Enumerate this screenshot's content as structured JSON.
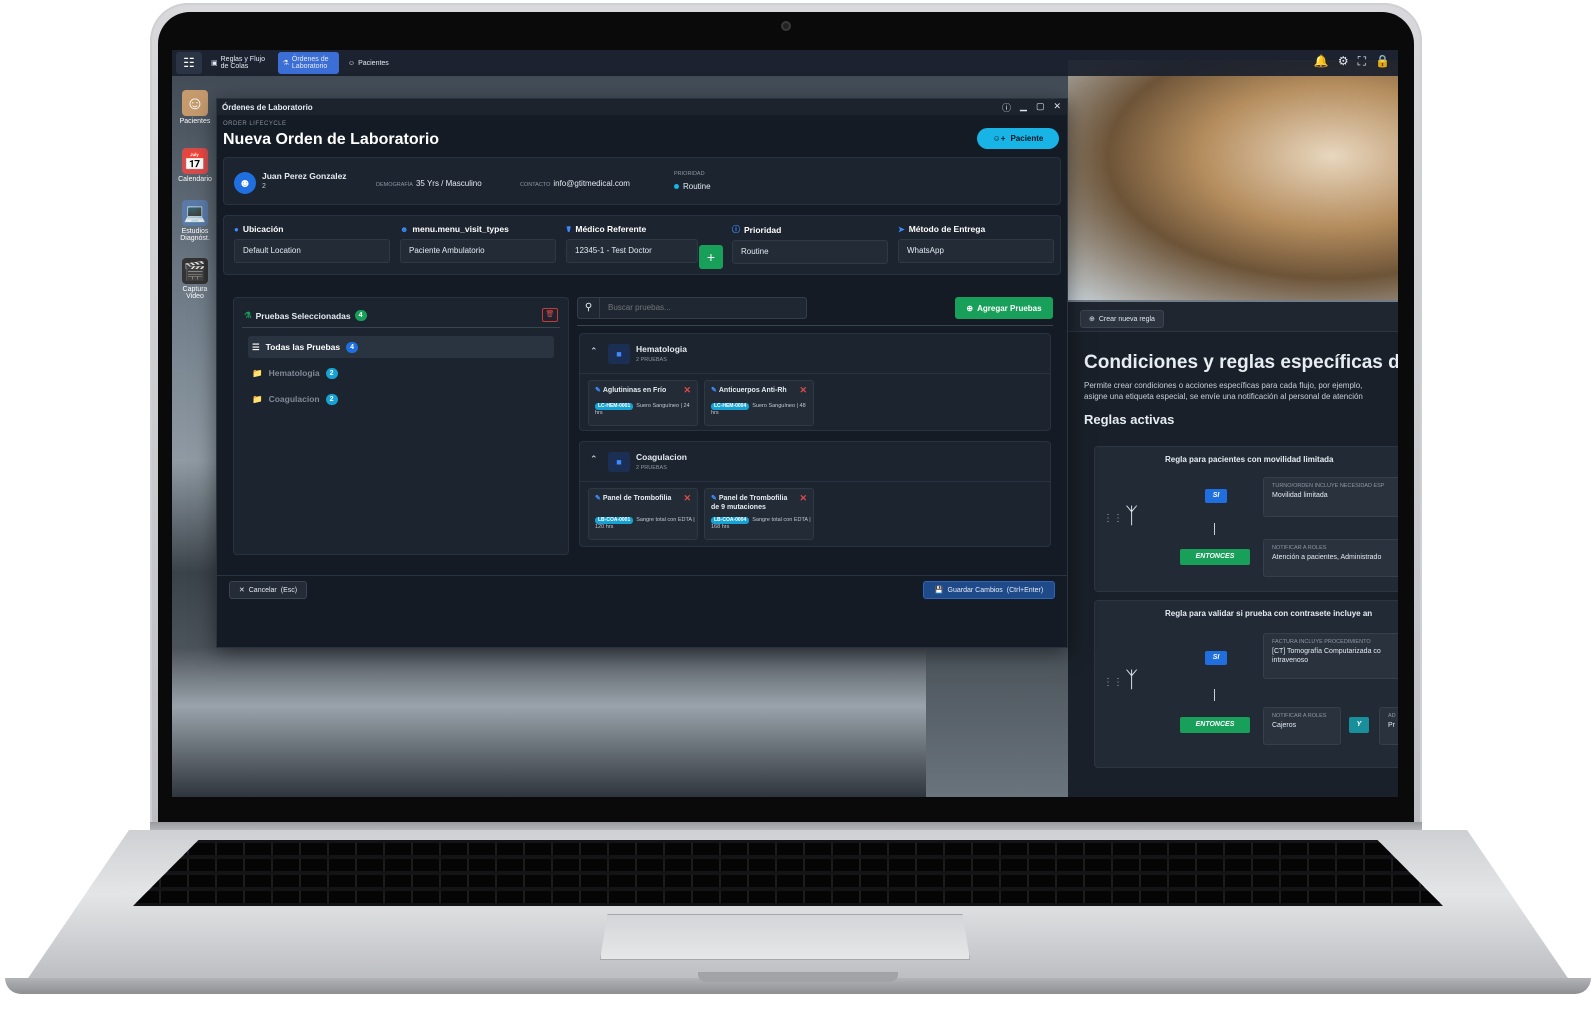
{
  "taskbar": {
    "tabs": [
      {
        "label": "Reglas y Flujo de Colas",
        "icon": "rules-icon"
      },
      {
        "label": "Órdenes de Laboratorio",
        "icon": "lab-icon"
      },
      {
        "label": "Pacientes",
        "icon": "patients-icon"
      }
    ]
  },
  "desktop": {
    "icons": [
      {
        "label": "Pacientes",
        "icon": "patients-icon"
      },
      {
        "label": "Calendario",
        "icon": "calendar-icon"
      },
      {
        "label": "Estudios Diagnóst.",
        "icon": "studies-icon"
      },
      {
        "label": "Captura Video",
        "icon": "video-icon"
      }
    ]
  },
  "modal": {
    "window_title": "Órdenes de Laboratorio",
    "lifecycle": "ORDER LIFECYCLE",
    "heading": "Nueva Orden de Laboratorio",
    "patient_button": "Paciente",
    "patient": {
      "name": "Juan Perez Gonzalez",
      "id": "2",
      "demo_label": "DEMOGRAFÍA",
      "demo_value": "35 Yrs / Masculino",
      "contact_label": "CONTACTO",
      "contact_value": "info@gtitmedical.com",
      "priority_label": "PRIORIDAD",
      "priority_value": "Routine"
    },
    "fields": [
      {
        "label": "Ubicación",
        "value": "Default Location",
        "icon": "location-pin-icon"
      },
      {
        "label": "menu.menu_visit_types",
        "value": "Paciente Ambulatorio",
        "icon": "person-icon"
      },
      {
        "label": "Médico Referente",
        "value": "12345-1 - Test Doctor",
        "icon": "stethoscope-icon"
      },
      {
        "label": "Prioridad",
        "value": "Routine",
        "icon": "info-icon"
      },
      {
        "label": "Método de Entrega",
        "value": "WhatsApp",
        "icon": "send-icon"
      }
    ],
    "selected": {
      "title": "Pruebas Seleccionadas",
      "count": "4",
      "items": [
        {
          "label": "Todas las Pruebas",
          "count": "4"
        },
        {
          "label": "Hematologia",
          "count": "2"
        },
        {
          "label": "Coagulacion",
          "count": "2"
        }
      ]
    },
    "search_placeholder": "Buscar pruebas...",
    "add_tests": "Agregar Pruebas",
    "groups": [
      {
        "name": "Hematologia",
        "count": "2 PRUEBAS",
        "tests": [
          {
            "name": "Aglutininas en Frío",
            "code": "LC-HEM-0001",
            "detail": "Suero Sanguíneo | 24 hrs"
          },
          {
            "name": "Anticuerpos Anti-Rh",
            "code": "LC-HEM-0004",
            "detail": "Suero Sanguíneo | 48 hrs"
          }
        ]
      },
      {
        "name": "Coagulacion",
        "count": "2 PRUEBAS",
        "tests": [
          {
            "name": "Panel de Trombofilia",
            "code": "LB-COA-0001",
            "detail": "Sangre total con EDTA | 120 hrs"
          },
          {
            "name": "Panel de Trombofilia de 9 mutaciones",
            "code": "LB-COA-0004",
            "detail": "Sangre total con EDTA | 168 hrs"
          }
        ]
      }
    ],
    "cancel": "Cancelar",
    "cancel_key": "(Esc)",
    "save": "Guardar Cambios",
    "save_key": "(Ctrl+Enter)"
  },
  "rules": {
    "new_rule": "Crear nueva regla",
    "heading": "Condiciones y reglas específicas de at",
    "description_1": "Permite crear condiciones o acciones específicas para cada flujo, por ejemplo,",
    "description_2": "asigne una etiqueta especial, se envíe una notificación al personal de atención",
    "active": "Reglas activas",
    "items": [
      {
        "title": "Regla para pacientes con movilidad limitada",
        "if": "SI",
        "cond_key": "TURNO/ORDEN INCLUYE NECESIDAD ESP",
        "cond_value": "Movilidad limitada",
        "then": "ENTONCES",
        "action_key": "NOTIFICAR A ROLES",
        "action_value": "Atención a pacientes, Administrado"
      },
      {
        "title": "Regla para validar si prueba con contrasete incluye an",
        "if": "SI",
        "cond_key": "FACTURA INCLUYE PROCEDIMIENTO",
        "cond_value": "[CT] Tomografía Computarizada co",
        "cond_value_2": "intravenoso",
        "then": "ENTONCES",
        "action_key": "NOTIFICAR A ROLES",
        "action_value": "Cajeros",
        "and": "Y",
        "extra_key": "AD",
        "extra_value": "Pr"
      }
    ]
  }
}
